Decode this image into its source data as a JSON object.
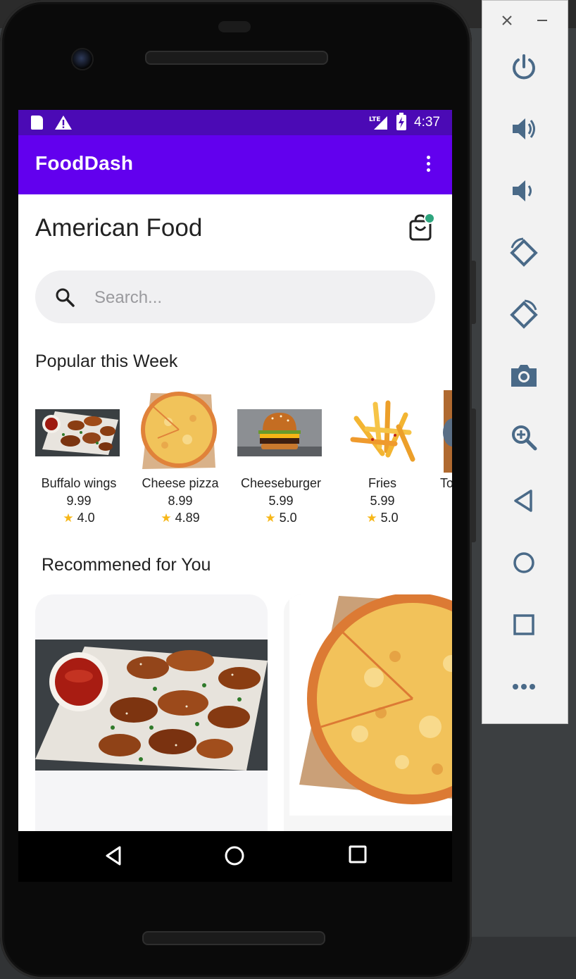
{
  "status_bar": {
    "time": "4:37",
    "network": "LTE"
  },
  "app_bar": {
    "title": "FoodDash"
  },
  "header": {
    "title": "American Food"
  },
  "search": {
    "placeholder": "Search..."
  },
  "sections": {
    "popular": "Popular this Week",
    "recommended": "Recommened for You"
  },
  "popular_items": [
    {
      "name": "Buffalo wings",
      "price": "9.99",
      "rating": "4.0"
    },
    {
      "name": "Cheese pizza",
      "price": "8.99",
      "rating": "4.89"
    },
    {
      "name": "Cheeseburger",
      "price": "5.99",
      "rating": "5.0"
    },
    {
      "name": "Fries",
      "price": "5.99",
      "rating": "5.0"
    },
    {
      "name": "To",
      "price": "",
      "rating": ""
    }
  ],
  "colors": {
    "status_bar": "#4b0ab5",
    "app_bar": "#6200ee",
    "rating_star": "#f7b718",
    "cart_badge": "#2ea57e"
  },
  "icons": [
    "sd-card-icon",
    "warning-icon",
    "lte-signal-icon",
    "battery-charging-icon",
    "overflow-menu-icon",
    "shopping-bag-icon",
    "search-icon",
    "star-icon",
    "back-icon",
    "home-icon",
    "recents-icon",
    "close-icon",
    "minimize-icon",
    "power-icon",
    "volume-up-icon",
    "volume-down-icon",
    "rotate-left-icon",
    "rotate-right-icon",
    "camera-icon",
    "zoom-icon",
    "more-icon"
  ]
}
